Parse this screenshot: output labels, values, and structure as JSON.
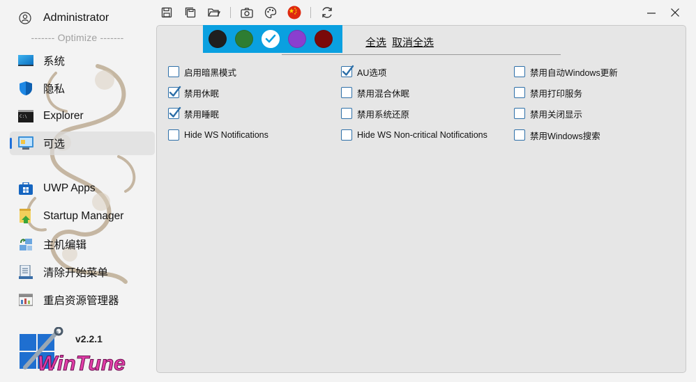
{
  "user": {
    "name": "Administrator",
    "icon": "user-icon"
  },
  "sidebar": {
    "group_title": "------- Optimize -------",
    "items": [
      {
        "label": "系统",
        "icon": "monitor-icon",
        "active": false
      },
      {
        "label": "隐私",
        "icon": "shield-icon",
        "active": false
      },
      {
        "label": "Explorer",
        "icon": "terminal-icon",
        "active": false
      },
      {
        "label": "可选",
        "icon": "optional-icon",
        "active": true
      },
      {
        "label": "UWP Apps",
        "icon": "windows-apps-icon",
        "active": false
      },
      {
        "label": "Startup Manager",
        "icon": "startup-folder-icon",
        "active": false
      },
      {
        "label": "主机编辑",
        "icon": "hosts-edit-icon",
        "active": false
      },
      {
        "label": "清除开始菜单",
        "icon": "clear-start-menu-icon",
        "active": false
      },
      {
        "label": "重启资源管理器",
        "icon": "restart-explorer-icon",
        "active": false
      }
    ],
    "version": "v2.2.1",
    "logo_text": "WinTune"
  },
  "toolbar": {
    "buttons": [
      "save-icon",
      "save-all-icon",
      "open-folder-icon",
      "camera-icon",
      "palette-icon",
      "china-flag-icon",
      "refresh-icon"
    ]
  },
  "window": {
    "minimize": "minimize-icon",
    "close": "close-icon"
  },
  "colors": {
    "accent": "#1e6fd9",
    "color_bar": "#0aa0e0",
    "swatches": [
      "#1f1f1f",
      "#2e7d32",
      "#ffffff",
      "#8a3fcf",
      "#7a0a0a"
    ],
    "selected_swatch": 2,
    "checkbox_border": "#2d6fa8"
  },
  "selection": {
    "select_all": "全选",
    "deselect_all": "取消全选"
  },
  "options": [
    [
      {
        "label": "启用暗黑模式",
        "checked": false
      },
      {
        "label": "禁用休眠",
        "checked": true
      },
      {
        "label": "禁用睡眠",
        "checked": true
      },
      {
        "label": "Hide WS Notifications",
        "checked": false
      }
    ],
    [
      {
        "label": "AU选项",
        "checked": true
      },
      {
        "label": "禁用混合休眠",
        "checked": false
      },
      {
        "label": "禁用系统还原",
        "checked": false
      },
      {
        "label": "Hide WS Non-critical Notifications",
        "checked": false
      }
    ],
    [
      {
        "label": "禁用自动Windows更新",
        "checked": false
      },
      {
        "label": "禁用打印服务",
        "checked": false
      },
      {
        "label": "禁用关闭显示",
        "checked": false
      },
      {
        "label": "禁用Windows搜索",
        "checked": false
      }
    ]
  ]
}
